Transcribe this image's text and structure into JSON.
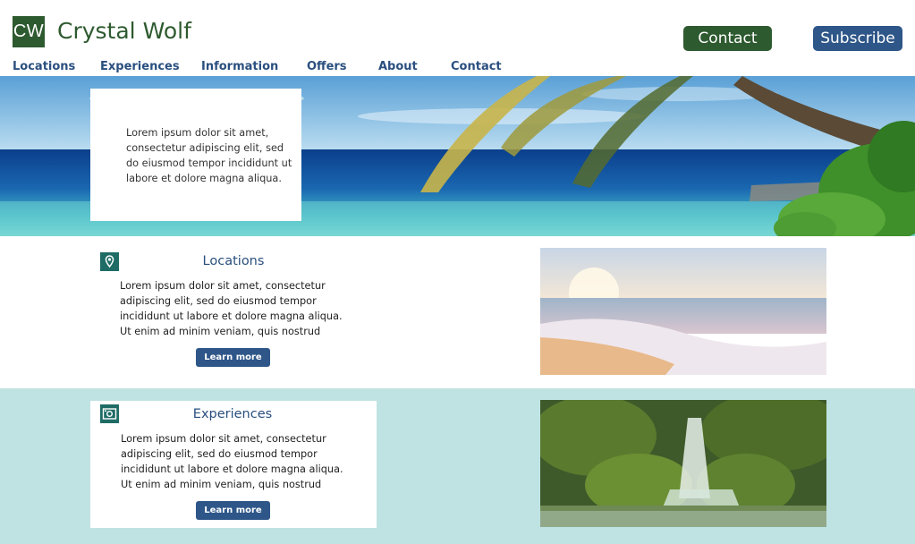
{
  "brand": {
    "initials": "CW",
    "name": "Crystal Wolf"
  },
  "header_buttons": {
    "contact": "Contact",
    "subscribe": "Subscribe"
  },
  "nav": [
    "Locations",
    "Experiences",
    "Information",
    "Offers",
    "About",
    "Contact"
  ],
  "hero": {
    "text": "Lorem ipsum dolor sit amet, consectetur adipiscing elit, sed do eiusmod tempor incididunt ut labore et dolore magna aliqua."
  },
  "features": [
    {
      "title": "Locations",
      "icon": "map-pin-icon",
      "text": "Lorem ipsum dolor sit amet, consectetur adipiscing elit, sed do eiusmod tempor incididunt ut labore et dolore magna aliqua. Ut enim ad minim veniam, quis nostrud",
      "button": "Learn more",
      "image": "beach-sunset-image"
    },
    {
      "title": "Experiences",
      "icon": "camera-icon",
      "text": "Lorem ipsum dolor sit amet, consectetur adipiscing elit, sed do eiusmod tempor incididunt ut labore et dolore magna aliqua. Ut enim ad minim veniam, quis nostrud",
      "button": "Learn more",
      "image": "waterfall-image"
    }
  ],
  "colors": {
    "green": "#2e5a2f",
    "navy": "#2e5688",
    "teal": "#1f6c66",
    "section_bg": "#bfe3e2"
  }
}
